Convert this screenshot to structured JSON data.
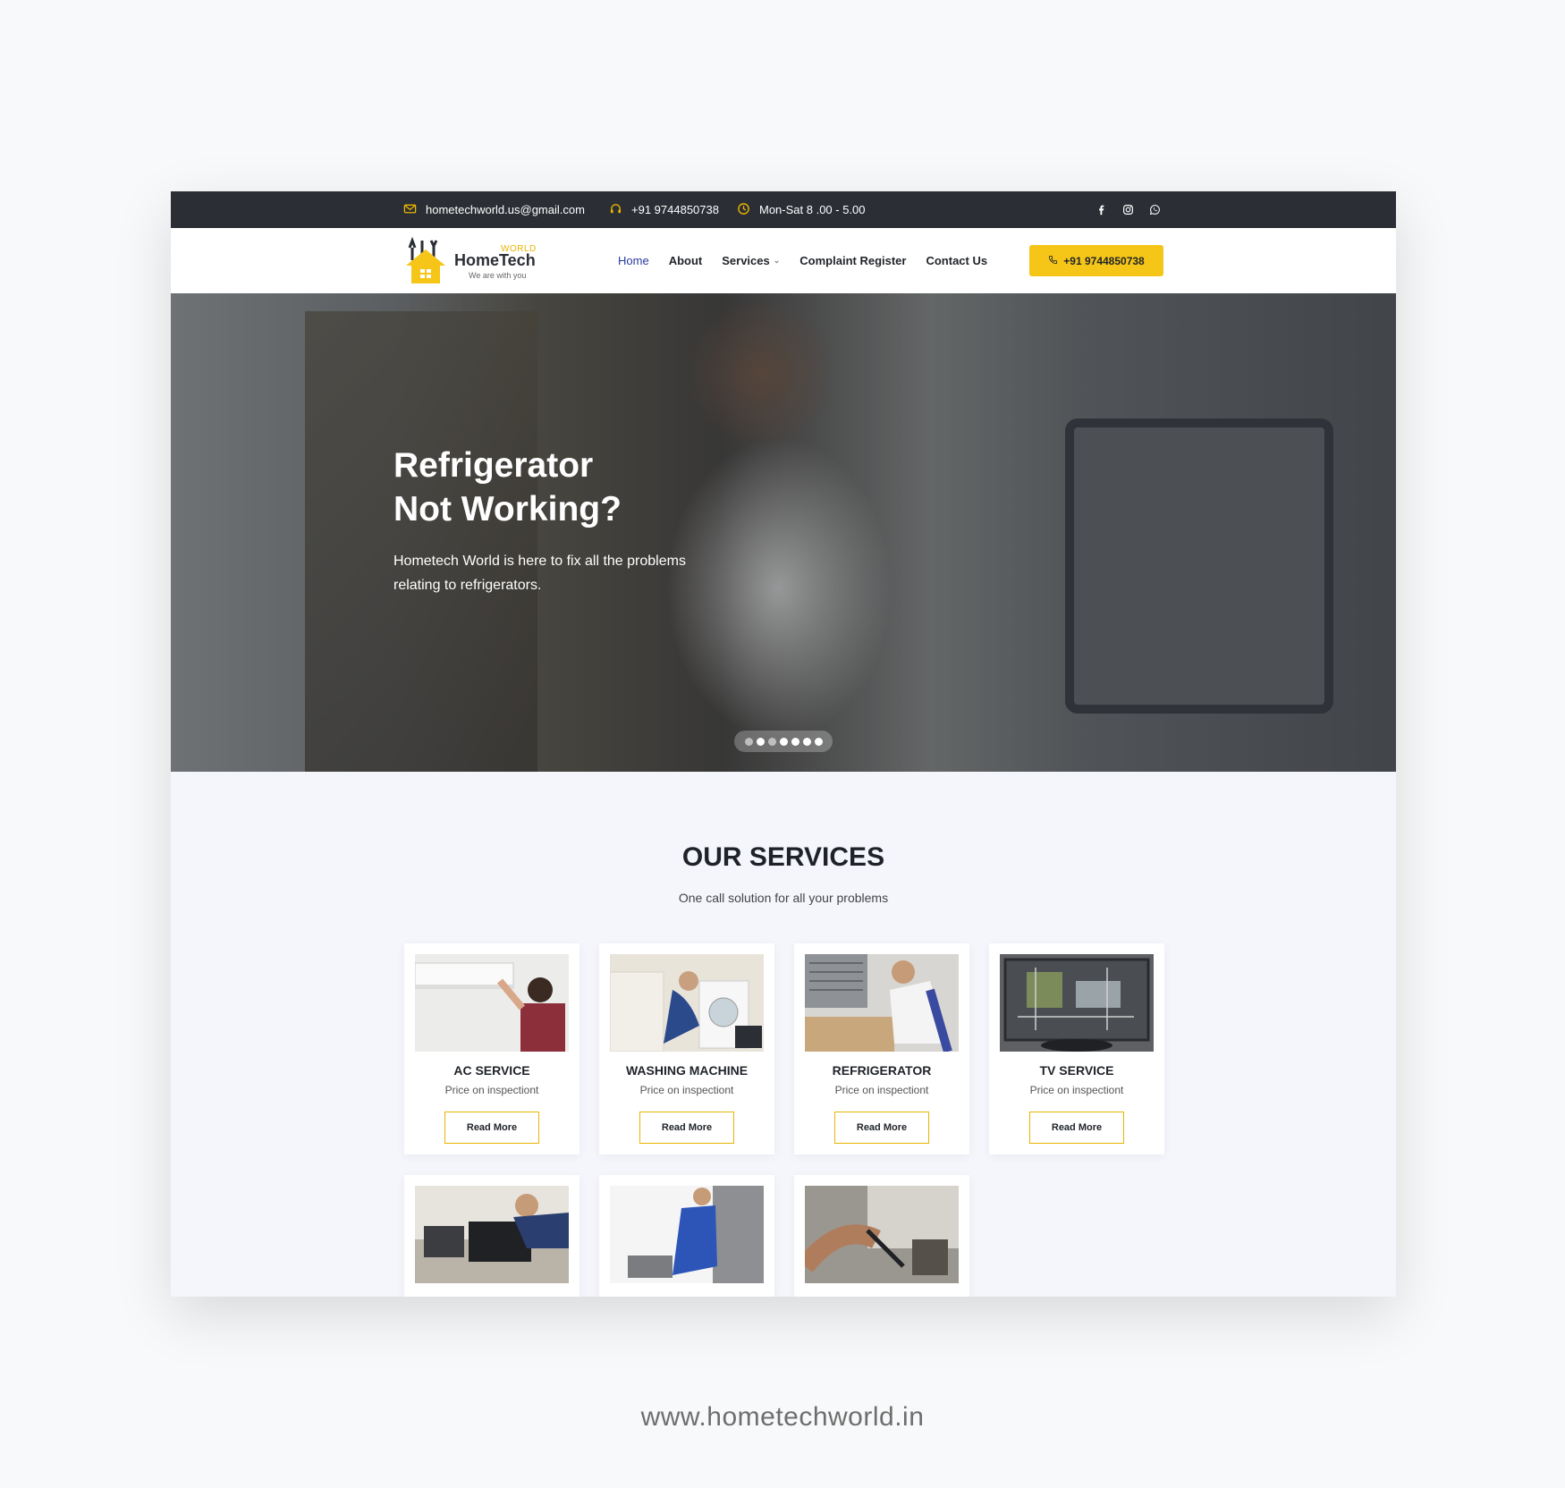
{
  "topbar": {
    "email": "hometechworld.us@gmail.com",
    "phone": "+91 9744850738",
    "hours": "Mon-Sat 8 .00 - 5.00",
    "icon_color": "#e8b400",
    "social": [
      "facebook-icon",
      "instagram-icon",
      "whatsapp-icon"
    ]
  },
  "logo": {
    "world": "WORLD",
    "name": "HomeTech",
    "tagline": "We are with you"
  },
  "nav": {
    "items": [
      {
        "label": "Home",
        "active": true
      },
      {
        "label": "About"
      },
      {
        "label": "Services",
        "has_dropdown": true
      },
      {
        "label": "Complaint Register"
      },
      {
        "label": "Contact Us"
      }
    ],
    "call_button": "+91 9744850738"
  },
  "hero": {
    "title_line1": "Refrigerator",
    "title_line2": "Not Working?",
    "text": "Hometech World is here to fix all the problems relating to refrigerators.",
    "slides_total": 7,
    "slides_dim": [
      0,
      2
    ]
  },
  "services": {
    "title": "OUR SERVICES",
    "subtitle": "One call solution for all your problems",
    "cards": [
      {
        "title": "AC SERVICE",
        "price": "Price on inspectiont",
        "button": "Read More"
      },
      {
        "title": "WASHING MACHINE",
        "price": "Price on inspectiont",
        "button": "Read More"
      },
      {
        "title": "REFRIGERATOR",
        "price": "Price on inspectiont",
        "button": "Read More"
      },
      {
        "title": "TV SERVICE",
        "price": "Price on inspectiont",
        "button": "Read More"
      }
    ]
  },
  "accent_color": "#f5c518",
  "dark_color": "#2b2e35",
  "footer_url": "www.hometechworld.in"
}
